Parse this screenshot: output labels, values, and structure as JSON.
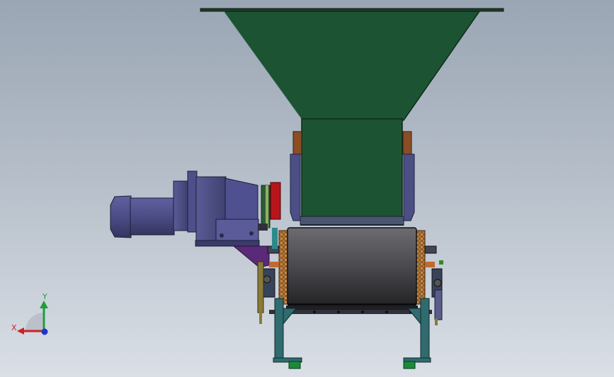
{
  "viewport": {
    "background_top": "#9aa6b4",
    "background_bottom": "#dadfe6"
  },
  "model": {
    "hopper_color": "#1c5433",
    "motor_color": "#4c4d86",
    "frame_color": "#2f6b6f",
    "drum_color": "#3f3f42"
  },
  "triad": {
    "x_label": "X",
    "y_label": "Y",
    "x_color": "#cc2222",
    "y_color": "#1e9e3a",
    "z_color": "#2233cc",
    "icon": "axis-triad-icon"
  }
}
